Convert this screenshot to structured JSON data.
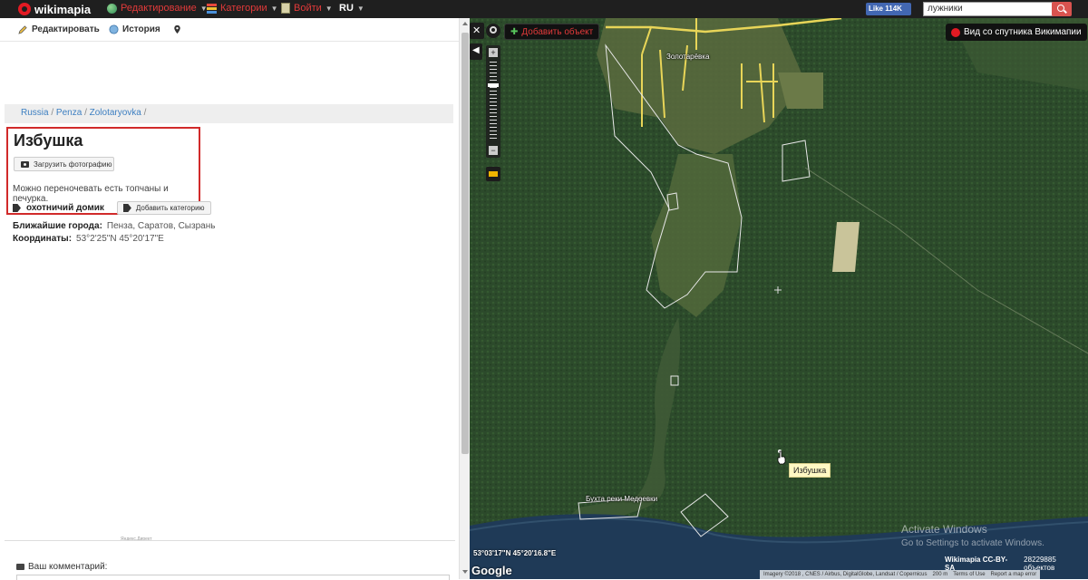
{
  "topbar": {
    "logo": "wikimapia",
    "nav": [
      {
        "label": "Редактирование",
        "icon": "globe-icon"
      },
      {
        "label": "Категории",
        "icon": "categories-icon"
      },
      {
        "label": "Войти",
        "icon": "door-icon"
      }
    ],
    "language": "RU",
    "facebook": "Like 114K",
    "search_value": "лужники"
  },
  "toolbar": {
    "edit_label": "Редактировать",
    "history_label": "История"
  },
  "breadcrumb": [
    "Russia",
    "Penza",
    "Zolotaryovka"
  ],
  "breadcrumb_sep": "/",
  "place": {
    "title": "Избушка",
    "upload_label": "Загрузить фотографию",
    "description": "Можно переночевать есть топчаны и печурка.",
    "category": "охотничий домик",
    "add_category_label": "Добавить категорию",
    "nearest_label": "Ближайшие города:",
    "nearest_value": "Пенза,  Саратов,  Сызрань",
    "coords_label": "Координаты:",
    "coords_value": "53°2'25\"N 45°20'17\"E"
  },
  "yandex_note": "Яндекс.Директ",
  "comment_label": "Ваш комментарий:",
  "map": {
    "add_object": "Добавить объект",
    "satellite_view": "Вид со спутника Викимапии",
    "village_label": "Золотарёвка",
    "bay_label": "Бухта реки Медоевки",
    "tooltip": "Избушка",
    "cursor_coords": "53°03'17\"N 45°20'16.8\"E",
    "google": "Google",
    "license": "Wikimapia CC-BY-SA",
    "objects_count": "28229885 объектов",
    "imagery": "Imagery ©2018 , CNES / Airbus, DigitalGlobe, Landsat / Copernicus",
    "scale": "200 m",
    "terms": "Terms of Use",
    "report": "Report a map error",
    "activate_title": "Activate Windows",
    "activate_sub": "Go to Settings to activate Windows."
  }
}
